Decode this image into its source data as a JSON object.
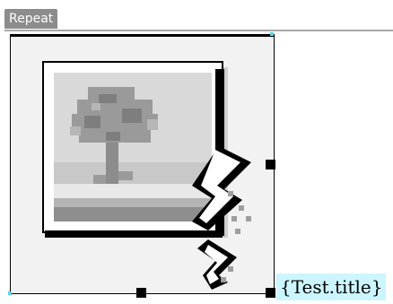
{
  "repeat_region": {
    "label": "Repeat"
  },
  "image_placeholder": {
    "icon": "broken-image-icon",
    "caption": "{Test.title}"
  },
  "colors": {
    "tab_background": "#8c8c8c",
    "caption_highlight": "#ccf6ff",
    "selection_handle": "#000000"
  }
}
